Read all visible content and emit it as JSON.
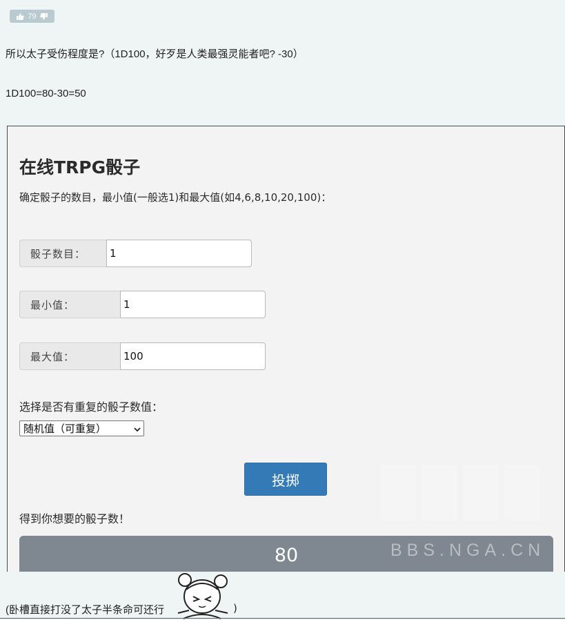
{
  "post": {
    "like_count": "79",
    "line1": "所以太子受伤程度是?（1D100，好歹是人类最强灵能者吧? -30）",
    "line2": "1D100=80-30=50",
    "footer_text": "(卧槽直接打没了太子半条命可还行",
    "footer_close": ")"
  },
  "dice_page": {
    "title": "在线TRPG骰子",
    "instruction": "确定骰子的数目，最小值(一般选1)和最大值(如4,6,8,10,20,100)：",
    "fields": [
      {
        "label": "骰子数目：",
        "value": "1"
      },
      {
        "label": "最小值：",
        "value": "1"
      },
      {
        "label": "最大值：",
        "value": "100"
      }
    ],
    "repeat_label": "选择是否有重复的骰子数值：",
    "repeat_select": "随机值（可重复）",
    "roll_button": "投掷",
    "result_caption": "得到你想要的骰子数！",
    "result_value": "80",
    "watermark": "BBS.NGA.CN"
  },
  "icons": {
    "like": "thumbs-up-icon",
    "dislike": "thumbs-down-icon",
    "select_arrow": "chevron-down-icon",
    "sticker": "anime-girl-sticker"
  },
  "colors": {
    "background": "#eff4f4",
    "like_badge": "#b9cbd0",
    "roll_button": "#337ab7",
    "result_bar": "#7f8891"
  }
}
